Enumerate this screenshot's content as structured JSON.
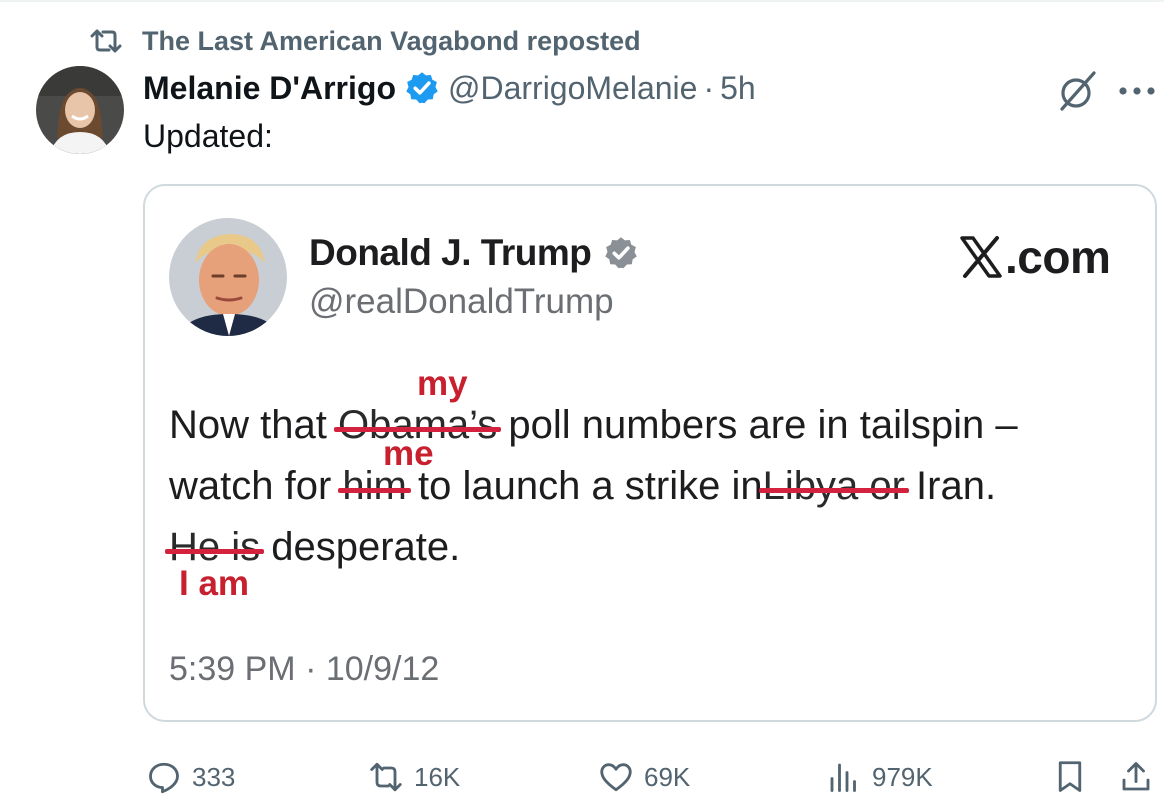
{
  "repost": {
    "label": "The Last American Vagabond reposted",
    "icon": "repost-icon"
  },
  "post": {
    "author_name": "Melanie D'Arrigo",
    "handle": "@DarrigoMelanie",
    "separator": "·",
    "time": "5h",
    "text": "Updated:"
  },
  "quoted": {
    "name": "Donald J. Trump",
    "handle": "@realDonaldTrump",
    "brand": ".com",
    "line1": {
      "a": "Now that ",
      "struck": "Obama’s",
      "b": " poll numbers are in tailspin –",
      "corr": "my"
    },
    "line2": {
      "a": "watch for ",
      "struck1": "him",
      "b": " to launch a strike in",
      "struck2": "Libya or",
      "c": " Iran.",
      "corr": "me"
    },
    "line3": {
      "struck": "He is",
      "b": " desperate.",
      "corr": "I am"
    },
    "timestamp": "5:39 PM · 10/9/12"
  },
  "actions": {
    "replies": "333",
    "reposts": "16K",
    "likes": "69K",
    "views": "979K"
  },
  "colors": {
    "accent": "#1d9bf0",
    "strike": "#d4213d",
    "muted": "#536471",
    "border": "#cfd9de"
  }
}
